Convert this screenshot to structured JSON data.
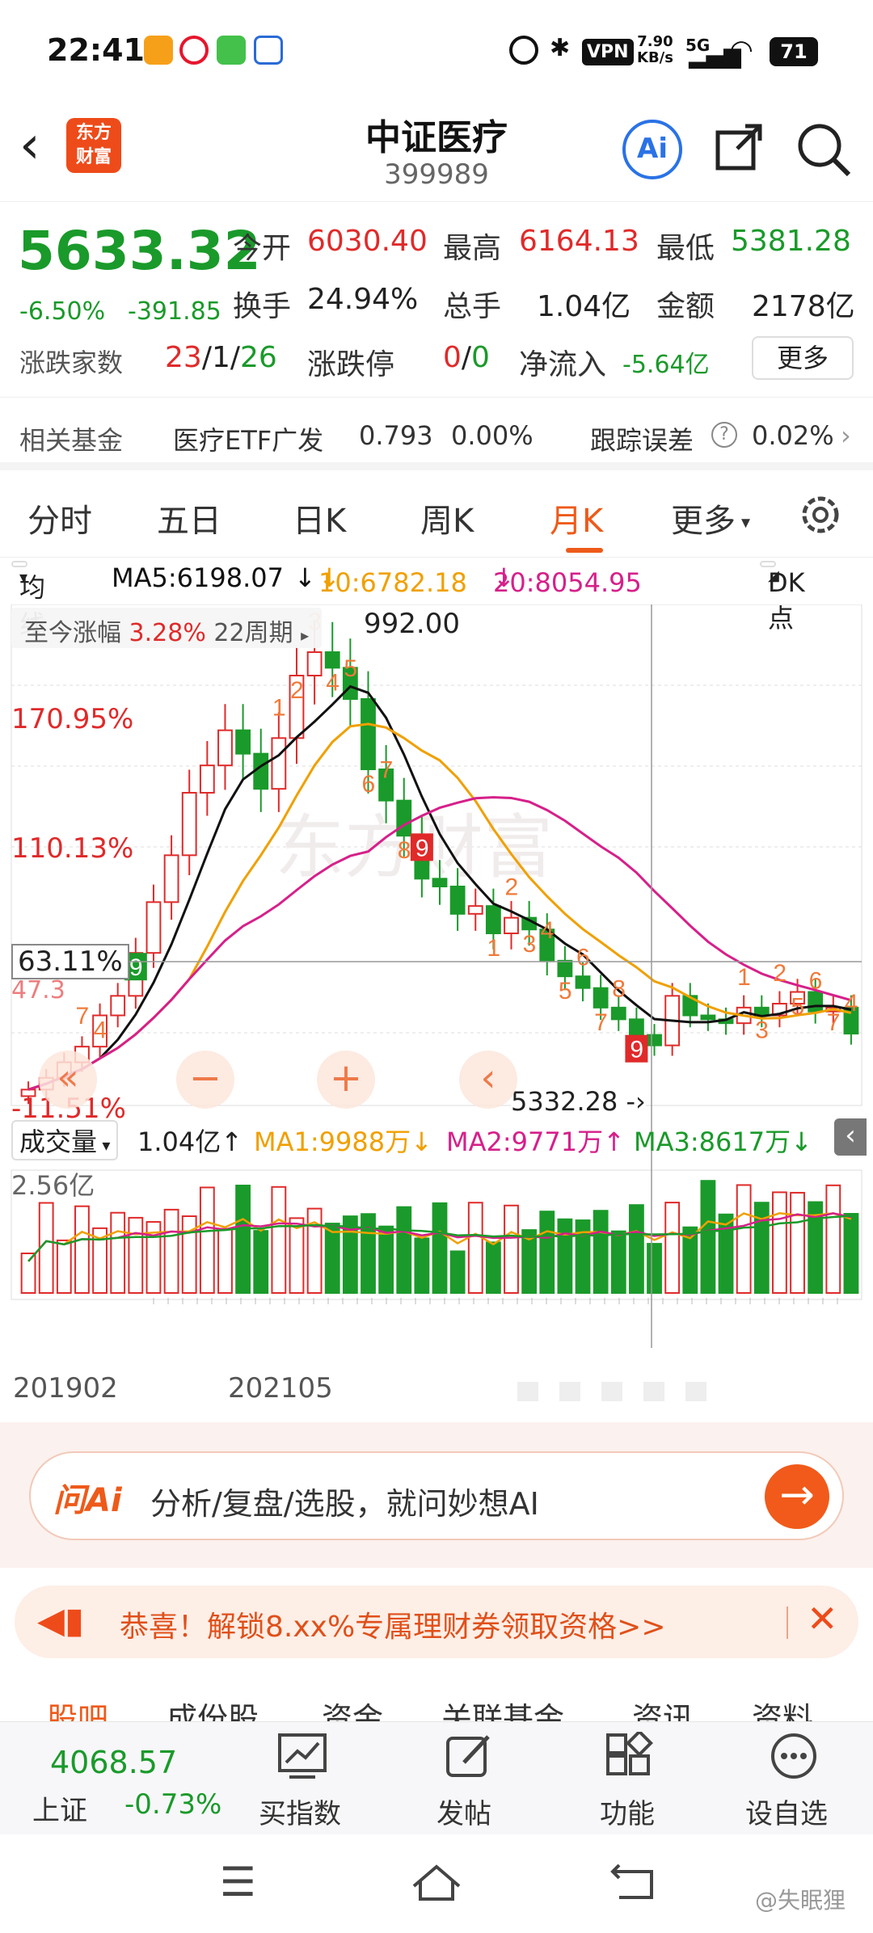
{
  "status_bar": {
    "time": "22:41",
    "vpn": "VPN",
    "speed_top": "7.90",
    "speed_bottom": "KB/s",
    "network": "5G",
    "battery": "71"
  },
  "header": {
    "logo_line1": "东方",
    "logo_line2": "财富",
    "title": "中证医疗",
    "code": "399989",
    "ai_label": "Ai"
  },
  "quote": {
    "price": "5633.32",
    "change_pct": "-6.50%",
    "change_abs": "-391.85",
    "open_label": "今开",
    "open": "6030.40",
    "high_label": "最高",
    "high": "6164.13",
    "low_label": "最低",
    "low": "5381.28",
    "turnover_label": "换手",
    "turnover": "24.94%",
    "volume_label": "总手",
    "volume": "1.04亿",
    "amount_label": "金额",
    "amount": "2178亿",
    "breadth_label": "涨跌家数",
    "breadth_up": "23",
    "breadth_flat": "1",
    "breadth_down": "26",
    "limit_label": "涨跌停",
    "limit_up": "0",
    "limit_down": "0",
    "netflow_label": "净流入",
    "netflow": "-5.64亿",
    "more_label": "更多"
  },
  "fund": {
    "label": "相关基金",
    "name": "医疗ETF广发",
    "price": "0.793",
    "change": "0.00%",
    "error_label": "跟踪误差",
    "error": "0.02%"
  },
  "tabs": [
    "分时",
    "五日",
    "日K",
    "周K",
    "月K",
    "更多"
  ],
  "active_tab": "月K",
  "ma_row": {
    "selector": "均线",
    "ma5": "MA5:6198.07",
    "ma10": "10:6782.18",
    "ma20": "20:8054.95",
    "dk": "DK点"
  },
  "chart": {
    "info_label": "至今涨幅",
    "info_pct": "3.28%",
    "info_period": "22周期",
    "top_price": "992.00",
    "y_labels": [
      "170.95%",
      "110.13%",
      "63.11%",
      "47.3",
      "-11.51%"
    ],
    "bottom_price": "5332.28",
    "vol_label": "成交量",
    "vol_value": "1.04亿",
    "vol_ma1": "MA1:9988万",
    "vol_ma2": "MA2:9771万",
    "vol_ma3": "MA3:8617万",
    "vol_max": "2.56亿",
    "x_labels": [
      "201902",
      "202105"
    ],
    "td_marks": [
      "7",
      "4",
      "6",
      "9",
      "1",
      "2",
      "3",
      "4",
      "5",
      "6",
      "7",
      "8",
      "9",
      "1",
      "2",
      "3",
      "4",
      "5",
      "6",
      "7",
      "8",
      "9",
      "2",
      "5",
      "6",
      "7",
      "1",
      "3",
      "4"
    ],
    "watermark": "东方财富",
    "colors": {
      "up": "#e02a2a",
      "down": "#1a9a2a",
      "ma5": "#111111",
      "ma10": "#f0a000",
      "ma20": "#d6208a"
    }
  },
  "chart_data": {
    "type": "candlestick",
    "title": "中证医疗 月K",
    "monthly_close_approx": [
      4200,
      4500,
      4900,
      5300,
      6100,
      6600,
      7700,
      9000,
      10200,
      11800,
      12500,
      13400,
      12800,
      11900,
      13200,
      14800,
      15400,
      15000,
      14200,
      12400,
      11600,
      10700,
      9600,
      9400,
      8700,
      8900,
      8200,
      8600,
      8300,
      7500,
      7100,
      6800,
      6300,
      6000,
      5600,
      5332,
      6600,
      6100,
      6000,
      5900,
      6300,
      6100,
      6400,
      6700,
      6200,
      6300,
      5633
    ]
  },
  "ai_bar": {
    "brand": "问Ai",
    "placeholder": "分析/复盘/选股，就问妙想AI"
  },
  "promo": {
    "text": "恭喜！解锁8.xx%专属理财券领取资格>>"
  },
  "sub_tabs": [
    "股吧",
    "成份股",
    "资金",
    "关联基金",
    "资讯",
    "资料"
  ],
  "bottom_bar": {
    "index_value": "4068.57",
    "index_name": "上证",
    "index_change": "-0.73%",
    "buy_label": "买指数",
    "post_label": "发帖",
    "func_label": "功能",
    "watch_label": "设自选"
  },
  "watermark_user": "@失眠狸"
}
